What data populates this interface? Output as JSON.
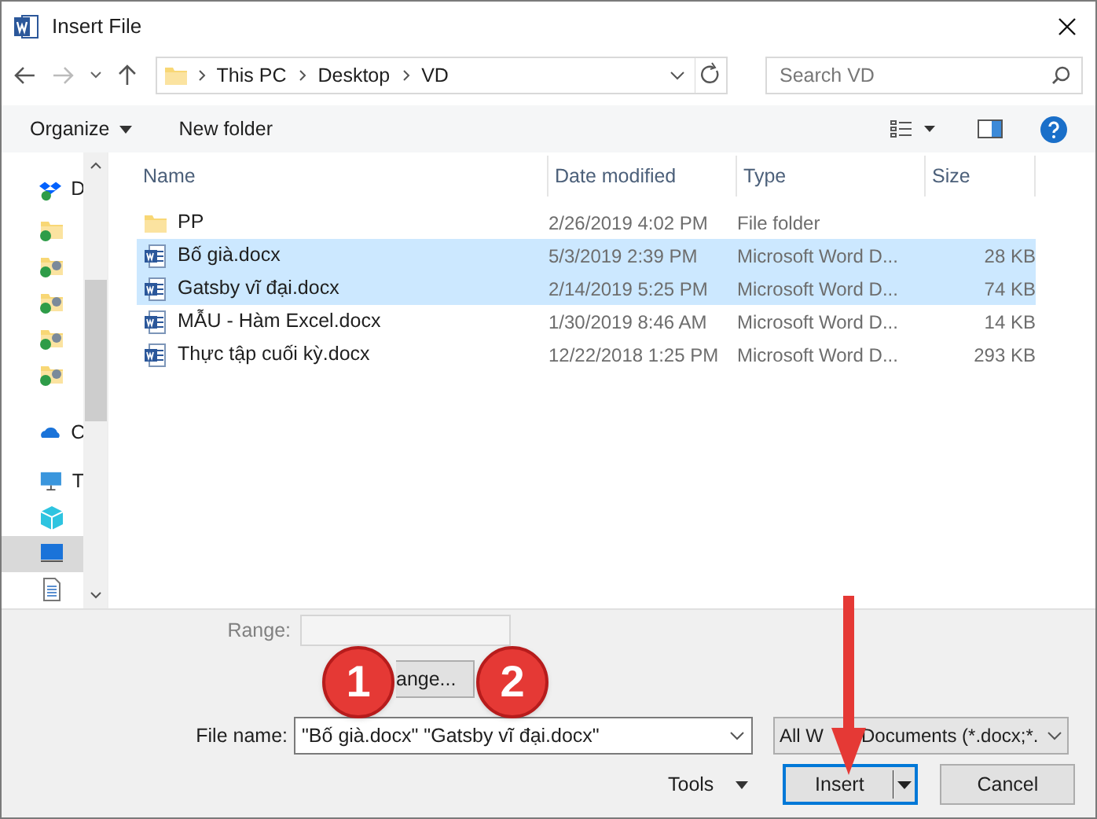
{
  "window": {
    "title": "Insert File"
  },
  "address": {
    "path": [
      "This PC",
      "Desktop",
      "VD"
    ]
  },
  "search": {
    "placeholder": "Search VD"
  },
  "toolbar": {
    "organize": "Organize",
    "new_folder": "New folder"
  },
  "nav": [
    {
      "kind": "dropbox",
      "label": "D",
      "selected": false
    },
    {
      "kind": "folder",
      "selected": false
    },
    {
      "kind": "shared",
      "selected": false
    },
    {
      "kind": "shared",
      "selected": false
    },
    {
      "kind": "shared",
      "selected": false
    },
    {
      "kind": "shared",
      "selected": false
    },
    {
      "kind": "onedrive",
      "label": "C",
      "selected": false
    },
    {
      "kind": "pc",
      "label": "T",
      "selected": false
    },
    {
      "kind": "cube",
      "selected": false
    },
    {
      "kind": "desktop",
      "selected": true
    },
    {
      "kind": "document",
      "selected": false
    }
  ],
  "table": {
    "columns": [
      "Name",
      "Date modified",
      "Type",
      "Size"
    ],
    "rows": [
      {
        "kind": "folder",
        "name": "PP",
        "date": "2/26/2019 4:02 PM",
        "type": "File folder",
        "selected": false
      },
      {
        "kind": "word",
        "name": "Bố già.docx",
        "date": "5/3/2019 2:39 PM",
        "type": "Microsoft Word D...",
        "size": "28 KB",
        "selected": true
      },
      {
        "kind": "word",
        "name": "Gatsby vĩ đại.docx",
        "date": "2/14/2019 5:25 PM",
        "type": "Microsoft Word D...",
        "size": "74 KB",
        "selected": true
      },
      {
        "kind": "word",
        "name": "MẪU - Hàm Excel.docx",
        "date": "1/30/2019 8:46 AM",
        "type": "Microsoft Word D...",
        "size": "14 KB",
        "selected": false
      },
      {
        "kind": "word",
        "name": "Thực tập cuối kỳ.docx",
        "date": "12/22/2018 1:25 PM",
        "type": "Microsoft Word D...",
        "size": "293 KB",
        "selected": false
      }
    ]
  },
  "range": {
    "label": "Range:",
    "button": "ange..."
  },
  "file_name": {
    "label": "File name:",
    "value": "\"Bố già.docx\" \"Gatsby vĩ đại.docx\""
  },
  "file_type": [
    "All W",
    "Documents (*.docx;*."
  ],
  "tools": "Tools",
  "buttons": [
    "Insert",
    "Cancel"
  ],
  "annotations": [
    {
      "label": "1"
    },
    {
      "label": "2"
    }
  ]
}
